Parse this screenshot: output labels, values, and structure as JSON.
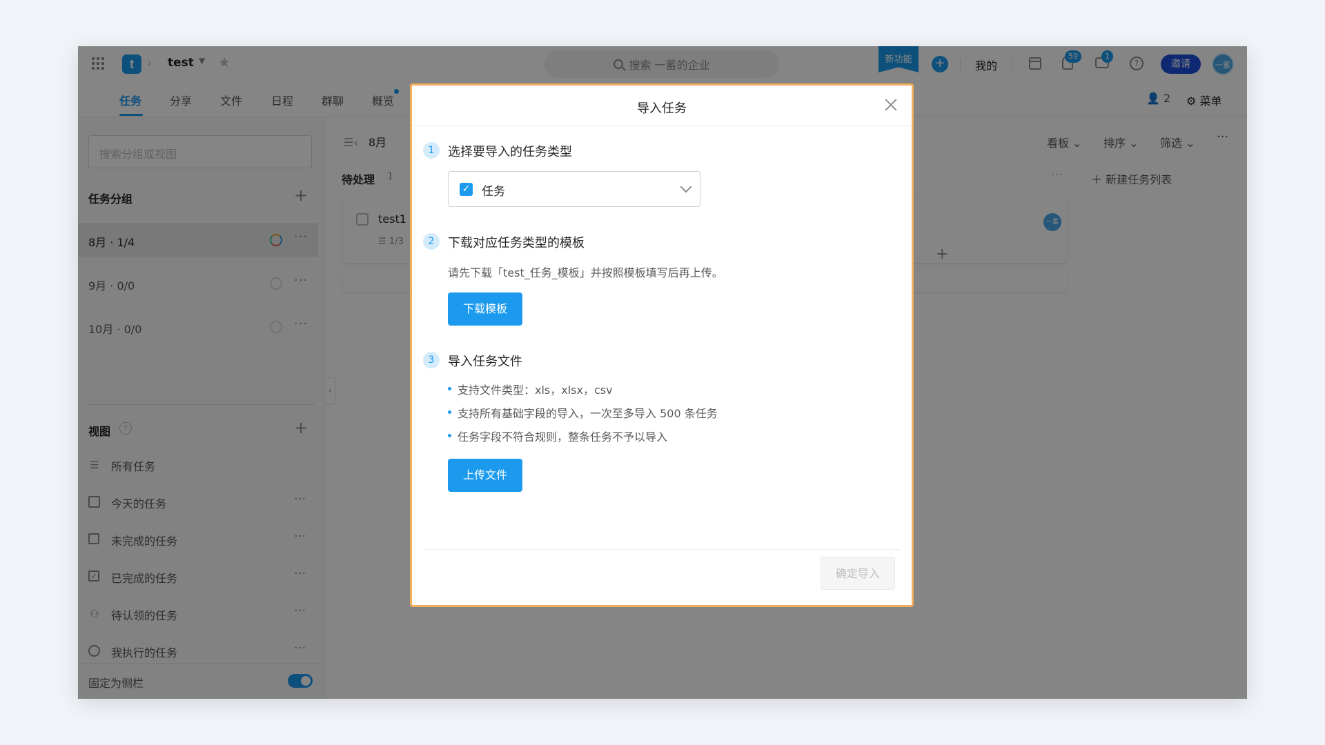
{
  "topbar": {
    "project_logo_letter": "t",
    "project_name": "test",
    "search_placeholder": "搜索 一蓄的企业",
    "new_feature_label": "新功能",
    "mine_label": "我的",
    "notification_count": "59",
    "message_count": "1",
    "invite_label": "邀请",
    "user_avatar_text": "一蓄"
  },
  "tabs": [
    {
      "label": "任务",
      "active": true
    },
    {
      "label": "分享"
    },
    {
      "label": "文件"
    },
    {
      "label": "日程"
    },
    {
      "label": "群聊"
    },
    {
      "label": "概览"
    }
  ],
  "tabbar_right": {
    "member_count": "2",
    "menu_label": "菜单"
  },
  "sidebar": {
    "search_placeholder": "搜索分组或视图",
    "groups_title": "任务分组",
    "groups": [
      {
        "label": "8月 · 1/4",
        "active": true
      },
      {
        "label": "9月 · 0/0"
      },
      {
        "label": "10月 · 0/0"
      }
    ],
    "views_title": "视图",
    "views": [
      {
        "label": "所有任务"
      },
      {
        "label": "今天的任务"
      },
      {
        "label": "未完成的任务"
      },
      {
        "label": "已完成的任务"
      },
      {
        "label": "待认领的任务"
      },
      {
        "label": "我执行的任务"
      }
    ],
    "pin_label": "固定为侧栏"
  },
  "board": {
    "month_title": "8月",
    "tools": {
      "kanban": "看板",
      "sort": "排序",
      "filter": "筛选"
    },
    "column_title": "待处理",
    "column_count": "1",
    "new_list_label": "新建任务列表",
    "task": {
      "name": "test1",
      "subtasks": "1/3",
      "avatar_text": "一蓄"
    }
  },
  "modal": {
    "title": "导入任务",
    "step1": {
      "number": "1",
      "title": "选择要导入的任务类型",
      "selected_type": "任务"
    },
    "step2": {
      "number": "2",
      "title": "下载对应任务类型的模板",
      "hint": "请先下载「test_任务_模板」并按照模板填写后再上传。",
      "button": "下载模板"
    },
    "step3": {
      "number": "3",
      "title": "导入任务文件",
      "bullets": [
        "支持文件类型：xls，xlsx，csv",
        "支持所有基础字段的导入，一次至多导入 500 条任务",
        "任务字段不符合规则，整条任务不予以导入"
      ],
      "button": "上传文件"
    },
    "confirm_button": "确定导入"
  },
  "colors": {
    "accent": "#1b9aee",
    "modal_border": "#f2ae5c",
    "invite": "#1b4fd8"
  }
}
